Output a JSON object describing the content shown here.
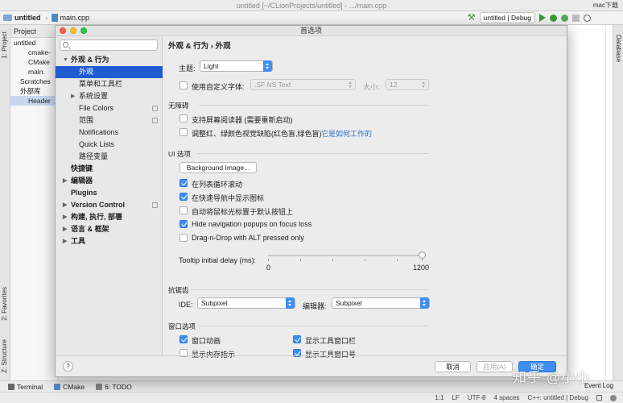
{
  "window": {
    "title": "untitled [~/CLionProjects/untitled] - .../main.cpp",
    "watermark": "mac下载"
  },
  "navbar": {
    "crumbs": [
      "untitled",
      "main.cpp"
    ],
    "run_config": "untitled | Debug"
  },
  "left_strip": {
    "project": "1: Project",
    "favorites": "2: Favorites",
    "structure": "Z: Structure"
  },
  "right_strip": {
    "database": "Database"
  },
  "project_panel": {
    "header": "Project",
    "rows": [
      "untitled",
      "cmake-",
      "CMake",
      "main.",
      "Scratches",
      "外部库",
      "Header"
    ]
  },
  "bottom_tools": {
    "terminal": "Terminal",
    "cmake": "CMake",
    "todo": "6: TODO"
  },
  "statusbar": {
    "event_log": "Event Log",
    "position": "1:1",
    "line_sep": "LF",
    "encoding": "UTF-8",
    "indent": "4 spaces",
    "context": "C++: untitled | Debug"
  },
  "dialog": {
    "title": "首选项",
    "search": {
      "placeholder": ""
    },
    "breadcrumb": "外观 & 行为  ›  外观",
    "tree": [
      {
        "label": "外观 & 行为",
        "bold": true,
        "arrow": "▼",
        "indent": 0
      },
      {
        "label": "外观",
        "selected": true,
        "indent": 1
      },
      {
        "label": "菜单和工具栏",
        "indent": 1
      },
      {
        "label": "系统设置",
        "arrow": "▶",
        "indent": 1
      },
      {
        "label": "File Colors",
        "indent": 1,
        "project": true
      },
      {
        "label": "范围",
        "indent": 1,
        "project": true
      },
      {
        "label": "Notifications",
        "indent": 1
      },
      {
        "label": "Quick Lists",
        "indent": 1
      },
      {
        "label": "路径变量",
        "indent": 1
      },
      {
        "label": "快捷键",
        "bold": true,
        "indent": 0
      },
      {
        "label": "编辑器",
        "bold": true,
        "arrow": "▶",
        "indent": 0
      },
      {
        "label": "Plugins",
        "bold": true,
        "indent": 0
      },
      {
        "label": "Version Control",
        "bold": true,
        "arrow": "▶",
        "indent": 0,
        "project": true
      },
      {
        "label": "构建, 执行, 部署",
        "bold": true,
        "arrow": "▶",
        "indent": 0
      },
      {
        "label": "语言 & 框架",
        "bold": true,
        "arrow": "▶",
        "indent": 0
      },
      {
        "label": "工具",
        "bold": true,
        "arrow": "▶",
        "indent": 0
      }
    ],
    "theme": {
      "label": "主题:",
      "value": "Light"
    },
    "custom_font": {
      "label": "使用自定义字体:",
      "checked": false,
      "font": ".SF NS Text",
      "size_label": "大小:",
      "size": "12"
    },
    "accessibility": {
      "title": "无障碍",
      "screen_reader": {
        "label": "支持屏幕阅读器 (需要重新启动)",
        "checked": false
      },
      "color_blind": {
        "label": "调整红、绿颜色视觉缺陷(红色盲,绿色盲)",
        "checked": false,
        "link": "它是如何工作的"
      }
    },
    "ui_options": {
      "title": "UI 选项",
      "bg_button": "Background Image...",
      "checks": [
        {
          "label": "在列表循环滚动",
          "checked": true
        },
        {
          "label": "在快速导航中显示图标",
          "checked": true
        },
        {
          "label": "自动将鼠标光标置于默认按钮上",
          "checked": false
        },
        {
          "label": "Hide navigation popups on focus loss",
          "checked": true
        },
        {
          "label": "Drag-n-Drop with ALT pressed only",
          "checked": false
        }
      ],
      "tooltip": {
        "label": "Tooltip initial delay (ms):",
        "min": "0",
        "max": "1200",
        "value": 1200
      }
    },
    "antialiasing": {
      "title": "抗锯齿",
      "ide_label": "IDE:",
      "ide_value": "Subpixel",
      "editor_label": "编辑器:",
      "editor_value": "Subpixel"
    },
    "window_options": {
      "title": "窗口选项",
      "left": [
        {
          "label": "窗口动画",
          "checked": true
        },
        {
          "label": "显示内存指示",
          "checked": false
        }
      ],
      "right": [
        {
          "label": "显示工具窗口栏",
          "checked": true
        },
        {
          "label": "显示工具窗口号",
          "checked": true
        }
      ]
    },
    "footer": {
      "help": "?",
      "cancel": "取消",
      "apply": "应用(A)",
      "ok": "确定"
    }
  },
  "watermark_bottom": "知乎 @小小"
}
